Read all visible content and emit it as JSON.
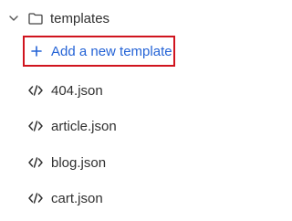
{
  "folder": {
    "name": "templates",
    "chevron_icon": "chevron-down-icon",
    "folder_icon": "folder-icon"
  },
  "add_template": {
    "label": "Add a new template",
    "icon": "plus-icon",
    "accent_color": "#2463d6",
    "highlight_color": "#d0141e"
  },
  "files": [
    {
      "name": "404.json",
      "icon": "code-icon"
    },
    {
      "name": "article.json",
      "icon": "code-icon"
    },
    {
      "name": "blog.json",
      "icon": "code-icon"
    },
    {
      "name": "cart.json",
      "icon": "code-icon"
    }
  ]
}
